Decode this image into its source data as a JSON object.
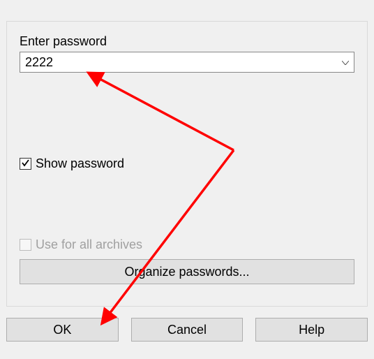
{
  "dialog": {
    "enter_password_label": "Enter password",
    "password_value": "2222",
    "show_password_label": "Show password",
    "show_password_checked": true,
    "use_all_archives_label": "Use for all archives",
    "use_all_archives_enabled": false,
    "organize_button_label": "Organize passwords..."
  },
  "buttons": {
    "ok": "OK",
    "cancel": "Cancel",
    "help": "Help"
  },
  "annotations": {
    "arrow_color": "#ff0000"
  }
}
